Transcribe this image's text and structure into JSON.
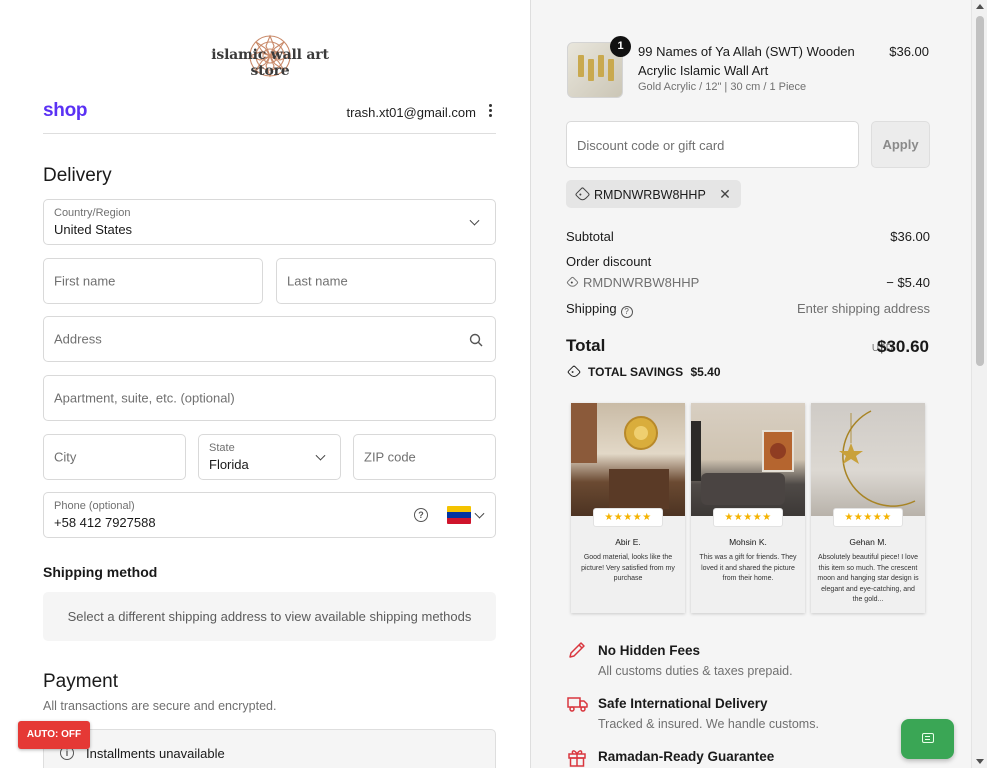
{
  "store": {
    "logo_text": "islamic wall art store"
  },
  "shop_header": {
    "shop_label": "shop",
    "email": "trash.xt01@gmail.com"
  },
  "delivery": {
    "heading": "Delivery",
    "country": {
      "label": "Country/Region",
      "value": "United States"
    },
    "first_name": {
      "placeholder": "First name"
    },
    "last_name": {
      "placeholder": "Last name"
    },
    "address": {
      "placeholder": "Address"
    },
    "apartment": {
      "placeholder": "Apartment, suite, etc. (optional)"
    },
    "city": {
      "placeholder": "City"
    },
    "state": {
      "label": "State",
      "value": "Florida"
    },
    "zip": {
      "placeholder": "ZIP code"
    },
    "phone": {
      "label": "Phone (optional)",
      "value": "+58 412 7927588"
    }
  },
  "shipping": {
    "heading": "Shipping method",
    "note": "Select a different shipping address to view available shipping methods"
  },
  "payment": {
    "heading": "Payment",
    "subtitle": "All transactions are secure and encrypted.",
    "installments": "Installments unavailable"
  },
  "auto_badge": "AUTO: OFF",
  "order": {
    "quantity": "1",
    "product_title": "99 Names of Ya Allah (SWT) Wooden Acrylic Islamic Wall Art",
    "product_variant": "Gold Acrylic / 12\" | 30 cm / 1 Piece",
    "product_price": "$36.00",
    "discount_placeholder": "Discount code or gift card",
    "apply_label": "Apply",
    "applied_code": "RMDNWRBW8HHP",
    "subtotal_label": "Subtotal",
    "subtotal_value": "$36.00",
    "order_discount_label": "Order discount",
    "discount_code": "RMDNWRBW8HHP",
    "discount_value": "− $5.40",
    "shipping_label": "Shipping",
    "shipping_value": "Enter shipping address",
    "total_label": "Total",
    "total_currency": "USD",
    "total_value": "$30.60",
    "savings_label": "TOTAL SAVINGS",
    "savings_value": "$5.40"
  },
  "reviews": [
    {
      "stars": "★★★★★",
      "name": "Abir E.",
      "text": "Good material, looks like the picture! Very satisfied from my purchase"
    },
    {
      "stars": "★★★★★",
      "name": "Mohsin K.",
      "text": "This was a gift for friends. They loved it and shared the picture from their home."
    },
    {
      "stars": "★★★★★",
      "name": "Gehan M.",
      "text": "Absolutely beautiful piece! I love this item so much. The crescent moon and hanging star design is elegant and eye-catching, and the gold..."
    }
  ],
  "features": [
    {
      "title": "No Hidden Fees",
      "subtitle": "All customs duties & taxes prepaid.",
      "icon": "pencil-icon"
    },
    {
      "title": "Safe International Delivery",
      "subtitle": "Tracked & insured. We handle customs.",
      "icon": "truck-icon"
    },
    {
      "title": "Ramadan-Ready Guarantee",
      "subtitle": "",
      "icon": "gift-icon"
    }
  ],
  "colors": {
    "shop_purple": "#5a31f4",
    "auto_badge_red": "#e53935",
    "chat_green": "#3aa655",
    "feature_icon_red": "#d9363e",
    "star_gold": "#f5b301"
  }
}
